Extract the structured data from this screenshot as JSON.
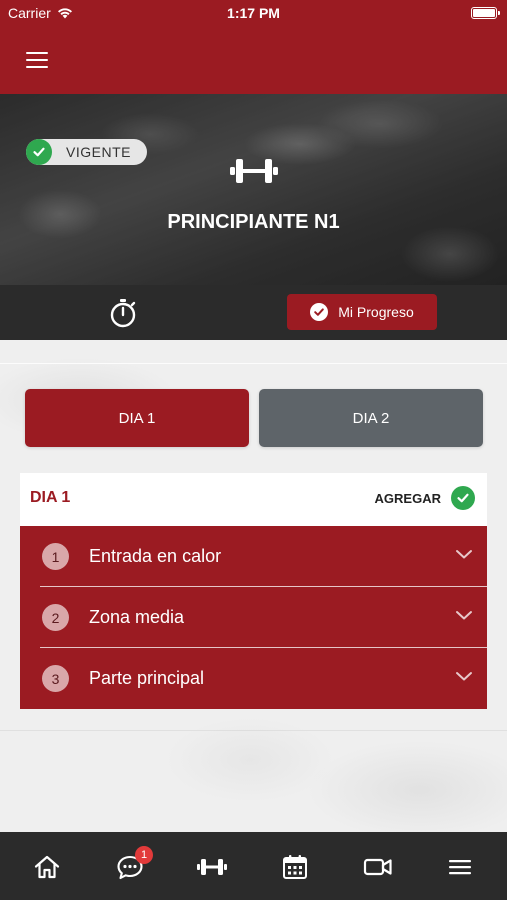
{
  "status_bar": {
    "carrier": "Carrier",
    "time": "1:17 PM"
  },
  "header": {
    "menu_icon": "hamburger-menu-icon"
  },
  "hero": {
    "status_badge": "VIGENTE",
    "plan_title": "PRINCIPIANTE N1",
    "icon": "dumbbell-icon"
  },
  "actions": {
    "timer_icon": "stopwatch-icon",
    "progress_label": "Mi Progreso"
  },
  "days": {
    "tabs": [
      {
        "label": "DIA 1",
        "active": true
      },
      {
        "label": "DIA 2",
        "active": false
      }
    ]
  },
  "day_card": {
    "title": "DIA 1",
    "add_label": "AGREGAR",
    "sections": [
      {
        "number": "1",
        "label": "Entrada en calor"
      },
      {
        "number": "2",
        "label": "Zona media"
      },
      {
        "number": "3",
        "label": "Parte principal"
      }
    ]
  },
  "tab_bar": {
    "items": [
      "home-icon",
      "chat-icon",
      "dumbbell-icon",
      "calendar-icon",
      "video-icon",
      "menu-icon"
    ],
    "chat_badge": "1"
  },
  "colors": {
    "brand": "#9b1b22",
    "success": "#2fa84f",
    "inactive_tab": "#5e6469",
    "dark_bar": "#2b2b2b",
    "notification": "#e23a3a"
  }
}
